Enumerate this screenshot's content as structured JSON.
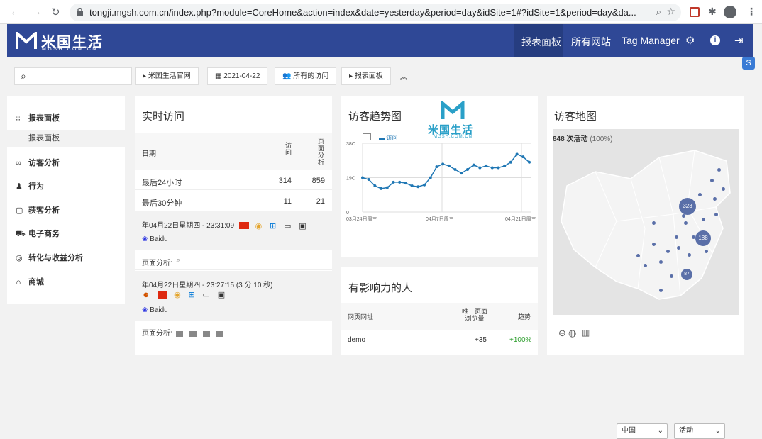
{
  "browser": {
    "url": "tongji.mgsh.com.cn/index.php?module=CoreHome&action=index&date=yesterday&period=day&idSite=1#?idSite=1&period=day&da..."
  },
  "topnav": {
    "logo_cn": "米国生活",
    "logo_en": "MGSH.COM.CN",
    "items": [
      "报表面板",
      "所有网站",
      "Tag Manager"
    ]
  },
  "toolbar": {
    "site": "米国生活官网",
    "date": "2021-04-22",
    "segment": "所有的访问",
    "dashboard": "报表面板"
  },
  "sidebar": {
    "items": [
      "报表面板",
      "访客分析",
      "行为",
      "获客分析",
      "电子商务",
      "转化与收益分析",
      "商城"
    ],
    "sub_item": "报表面板"
  },
  "realtime": {
    "title": "实时访问",
    "col_date": "日期",
    "col_visits": "访\n问",
    "col_pv": "页\n面\n分\n析",
    "rows": [
      {
        "label": "最后24小时",
        "visits": "314",
        "pv": "859"
      },
      {
        "label": "最后30分钟",
        "visits": "11",
        "pv": "21"
      }
    ],
    "visit1": {
      "time": "年04月22日星期四 - 23:31:09",
      "source": "Baidu",
      "pages_label": "页面分析:"
    },
    "visit2": {
      "time": "年04月22日星期四 - 23:27:15 (3 分 10 秒)",
      "source": "Baidu",
      "pages_label": "页面分析:"
    }
  },
  "trend": {
    "title": "访客趋势图",
    "watermark_cn": "米国生活",
    "watermark_en": "MGSH.COM.CN",
    "legend": "访问"
  },
  "chart_data": {
    "type": "line",
    "title": "访客趋势图",
    "x_ticks": [
      "03月24日周三",
      "04月7日周三",
      "04月21日周三"
    ],
    "y_ticks": [
      "0",
      "19C",
      "38C"
    ],
    "series": [
      {
        "name": "访问",
        "values": [
          190,
          180,
          145,
          130,
          135,
          165,
          165,
          160,
          145,
          140,
          150,
          190,
          250,
          265,
          255,
          235,
          215,
          235,
          260,
          245,
          255,
          245,
          245,
          255,
          275,
          320,
          305,
          275
        ]
      }
    ],
    "ylim": [
      0,
      380
    ]
  },
  "influencers": {
    "title": "有影响力的人",
    "col_url": "网页网址",
    "col_pv": "唯一页面\n浏览量",
    "col_trend": "趋势",
    "rows": [
      {
        "url": "demo",
        "pv": "+35",
        "trend": "+100%"
      }
    ]
  },
  "map": {
    "title": "访客地图",
    "summary": "848 次活动",
    "summary_pct": "(100%)",
    "bubbles": [
      "323",
      "188",
      "87"
    ],
    "region": "中国",
    "metric": "活动"
  }
}
